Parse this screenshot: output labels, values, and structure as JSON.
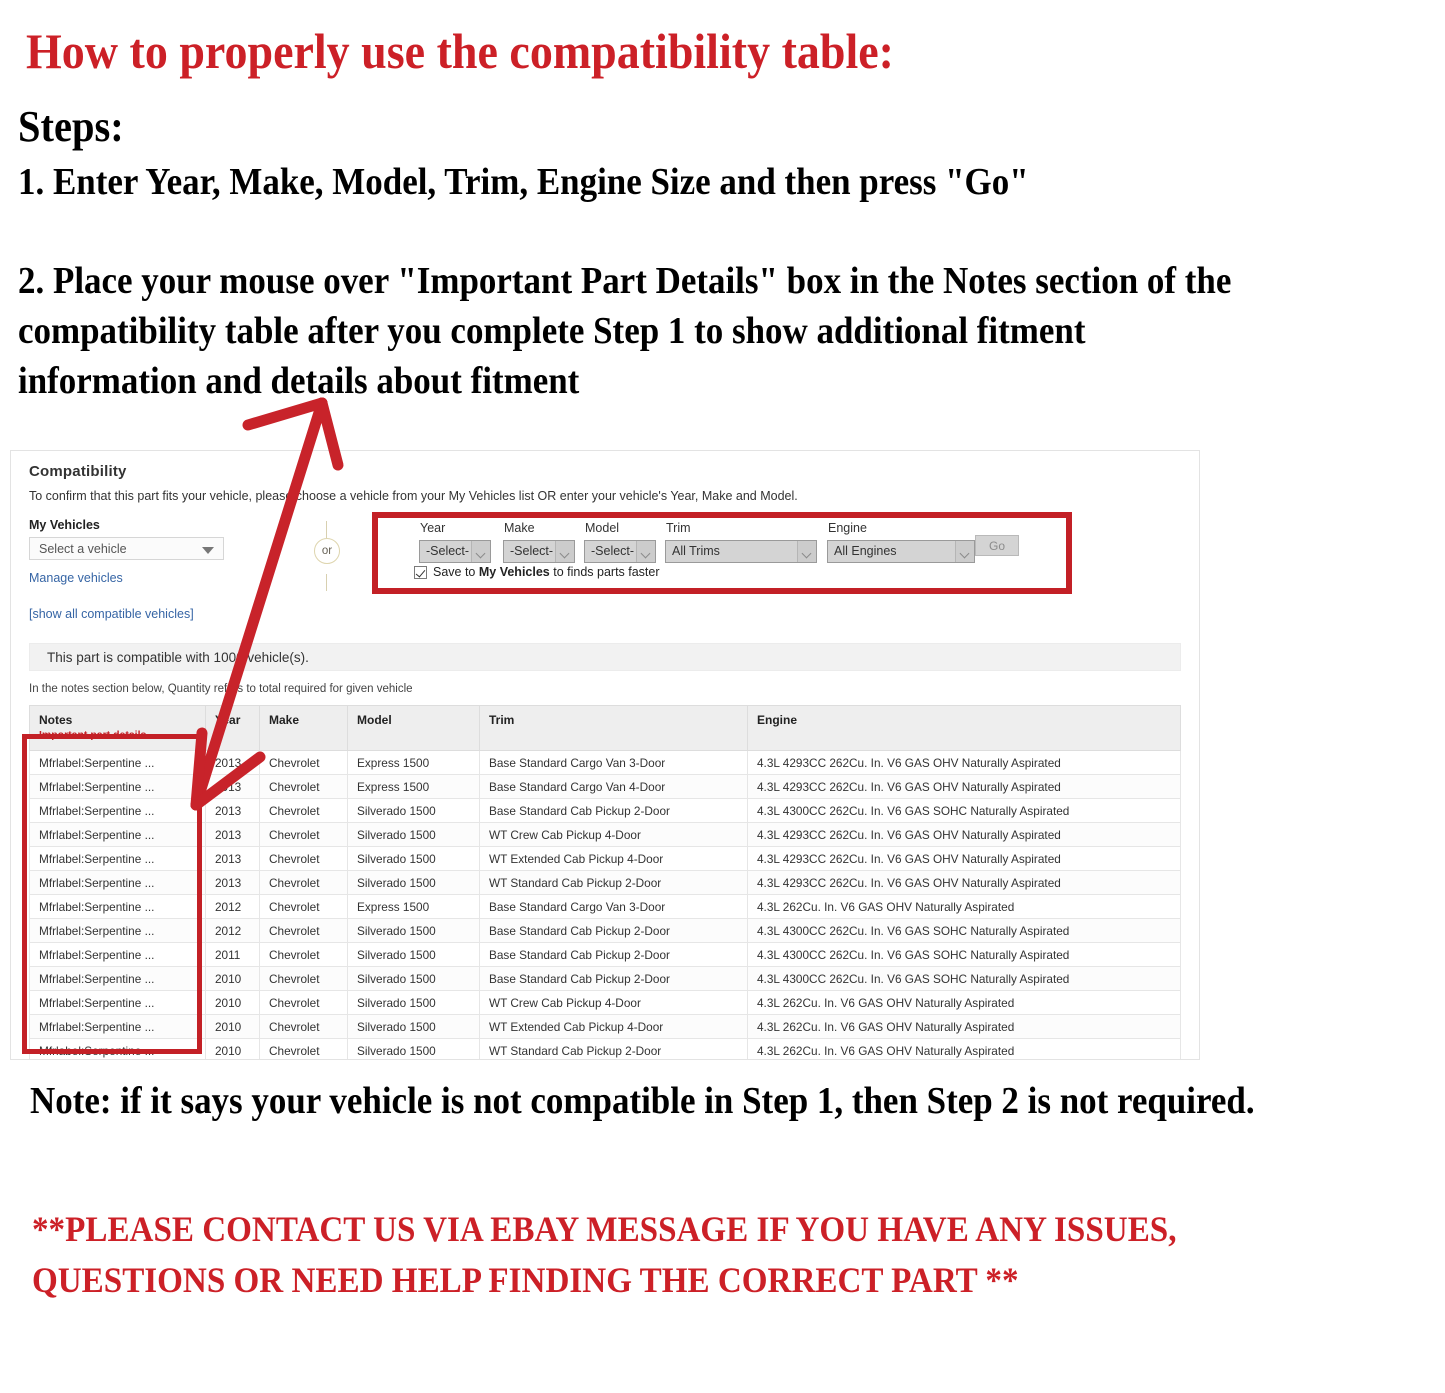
{
  "instructions": {
    "title": "How to properly use the compatibility table:",
    "steps_label": "Steps:",
    "step_1": "1. Enter Year, Make, Model, Trim, Engine Size and then press \"Go\"",
    "step_2": "2. Place your mouse over \"Important Part Details\" box in the Notes section of the compatibility table after you complete Step 1 to show additional fitment information and details about fitment",
    "note": "Note: if it says your vehicle is not compatible in Step 1, then Step 2 is not required.",
    "contact": "**PLEASE CONTACT US VIA EBAY MESSAGE IF YOU HAVE ANY ISSUES, QUESTIONS OR NEED HELP FINDING THE CORRECT PART **"
  },
  "colors": {
    "heading_red": "#CC2027",
    "highlight_red": "#C32026",
    "link_blue": "#3665A5"
  },
  "compatibility": {
    "title": "Compatibility",
    "subtitle": "To confirm that this part fits your vehicle, please choose a vehicle from your My Vehicles list OR enter your vehicle's Year, Make and Model.",
    "my_vehicles_label": "My Vehicles",
    "my_vehicles_value": "Select a vehicle",
    "manage_vehicles_link": "Manage vehicles",
    "show_all_link": "[show all compatible vehicles]",
    "or_divider": "or",
    "fields": [
      {
        "label": "Year",
        "value": "-Select-"
      },
      {
        "label": "Make",
        "value": "-Select-"
      },
      {
        "label": "Model",
        "value": "-Select-"
      },
      {
        "label": "Trim",
        "value": "All Trims"
      },
      {
        "label": "Engine",
        "value": "All Engines"
      }
    ],
    "go_button": "Go",
    "save_checkbox_checked": true,
    "save_text_before": "Save to ",
    "save_text_bold": "My Vehicles",
    "save_text_after": " to finds parts faster",
    "count_text": "This part is compatible with 1000 vehicle(s).",
    "notes_hint": "In the notes section below, Quantity refers to total required for given vehicle"
  },
  "table": {
    "headers": {
      "notes": "Notes",
      "notes_sub": "Important part details",
      "year": "Year",
      "make": "Make",
      "model": "Model",
      "trim": "Trim",
      "engine": "Engine"
    },
    "rows": [
      {
        "notes": "Mfrlabel:Serpentine ...",
        "year": "2013",
        "make": "Chevrolet",
        "model": "Express 1500",
        "trim": "Base Standard Cargo Van 3-Door",
        "engine": "4.3L 4293CC 262Cu. In. V6 GAS OHV Naturally Aspirated"
      },
      {
        "notes": "Mfrlabel:Serpentine ...",
        "year": "2013",
        "make": "Chevrolet",
        "model": "Express 1500",
        "trim": "Base Standard Cargo Van 4-Door",
        "engine": "4.3L 4293CC 262Cu. In. V6 GAS OHV Naturally Aspirated"
      },
      {
        "notes": "Mfrlabel:Serpentine ...",
        "year": "2013",
        "make": "Chevrolet",
        "model": "Silverado 1500",
        "trim": "Base Standard Cab Pickup 2-Door",
        "engine": "4.3L 4300CC 262Cu. In. V6 GAS SOHC Naturally Aspirated"
      },
      {
        "notes": "Mfrlabel:Serpentine ...",
        "year": "2013",
        "make": "Chevrolet",
        "model": "Silverado 1500",
        "trim": "WT Crew Cab Pickup 4-Door",
        "engine": "4.3L 4293CC 262Cu. In. V6 GAS OHV Naturally Aspirated"
      },
      {
        "notes": "Mfrlabel:Serpentine ...",
        "year": "2013",
        "make": "Chevrolet",
        "model": "Silverado 1500",
        "trim": "WT Extended Cab Pickup 4-Door",
        "engine": "4.3L 4293CC 262Cu. In. V6 GAS OHV Naturally Aspirated"
      },
      {
        "notes": "Mfrlabel:Serpentine ...",
        "year": "2013",
        "make": "Chevrolet",
        "model": "Silverado 1500",
        "trim": "WT Standard Cab Pickup 2-Door",
        "engine": "4.3L 4293CC 262Cu. In. V6 GAS OHV Naturally Aspirated"
      },
      {
        "notes": "Mfrlabel:Serpentine ...",
        "year": "2012",
        "make": "Chevrolet",
        "model": "Express 1500",
        "trim": "Base Standard Cargo Van 3-Door",
        "engine": "4.3L 262Cu. In. V6 GAS OHV Naturally Aspirated"
      },
      {
        "notes": "Mfrlabel:Serpentine ...",
        "year": "2012",
        "make": "Chevrolet",
        "model": "Silverado 1500",
        "trim": "Base Standard Cab Pickup 2-Door",
        "engine": "4.3L 4300CC 262Cu. In. V6 GAS SOHC Naturally Aspirated"
      },
      {
        "notes": "Mfrlabel:Serpentine ...",
        "year": "2011",
        "make": "Chevrolet",
        "model": "Silverado 1500",
        "trim": "Base Standard Cab Pickup 2-Door",
        "engine": "4.3L 4300CC 262Cu. In. V6 GAS SOHC Naturally Aspirated"
      },
      {
        "notes": "Mfrlabel:Serpentine ...",
        "year": "2010",
        "make": "Chevrolet",
        "model": "Silverado 1500",
        "trim": "Base Standard Cab Pickup 2-Door",
        "engine": "4.3L 4300CC 262Cu. In. V6 GAS SOHC Naturally Aspirated"
      },
      {
        "notes": "Mfrlabel:Serpentine ...",
        "year": "2010",
        "make": "Chevrolet",
        "model": "Silverado 1500",
        "trim": "WT Crew Cab Pickup 4-Door",
        "engine": "4.3L 262Cu. In. V6 GAS OHV Naturally Aspirated"
      },
      {
        "notes": "Mfrlabel:Serpentine ...",
        "year": "2010",
        "make": "Chevrolet",
        "model": "Silverado 1500",
        "trim": "WT Extended Cab Pickup 4-Door",
        "engine": "4.3L 262Cu. In. V6 GAS OHV Naturally Aspirated"
      },
      {
        "notes": "Mfrlabel:Serpentine ...",
        "year": "2010",
        "make": "Chevrolet",
        "model": "Silverado 1500",
        "trim": "WT Standard Cab Pickup 2-Door",
        "engine": "4.3L 262Cu. In. V6 GAS OHV Naturally Aspirated"
      }
    ]
  }
}
